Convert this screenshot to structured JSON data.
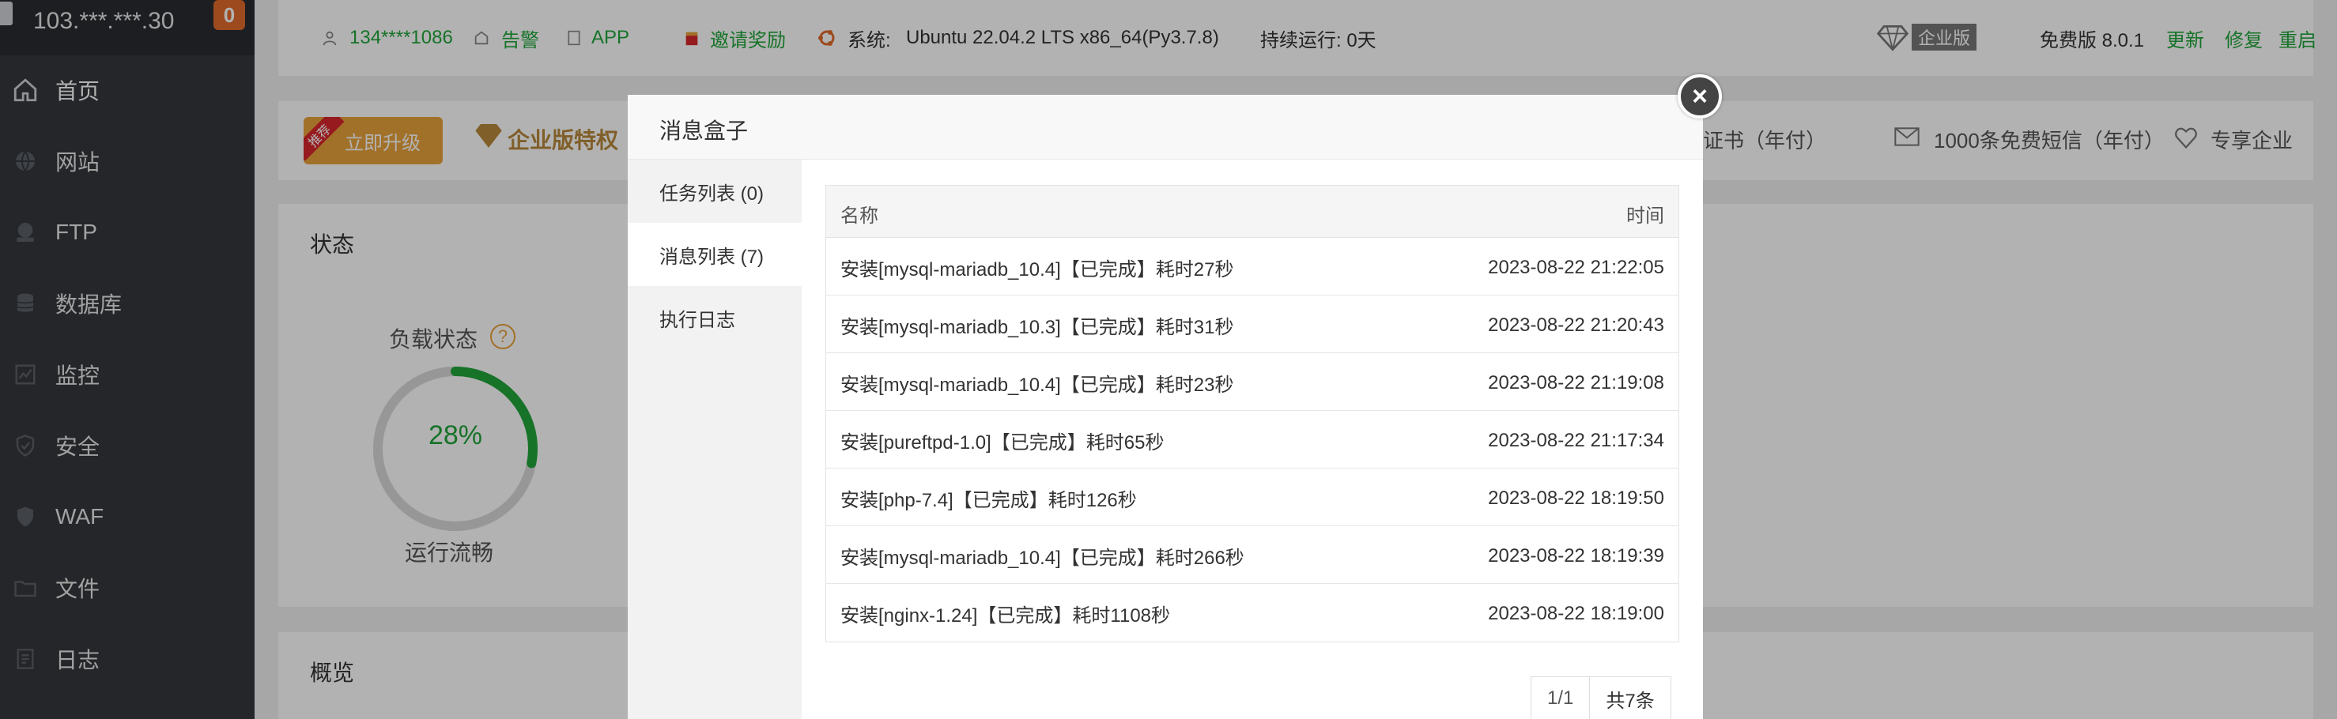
{
  "sidebar": {
    "server_ip": "103.***.***.30",
    "badge_count": "0",
    "items": [
      {
        "label": "首页",
        "icon": "home-icon"
      },
      {
        "label": "网站",
        "icon": "globe-icon"
      },
      {
        "label": "FTP",
        "icon": "ftp-icon"
      },
      {
        "label": "数据库",
        "icon": "database-icon"
      },
      {
        "label": "监控",
        "icon": "monitor-icon"
      },
      {
        "label": "安全",
        "icon": "shield-icon"
      },
      {
        "label": "WAF",
        "icon": "waf-shield-icon"
      },
      {
        "label": "文件",
        "icon": "folder-icon"
      },
      {
        "label": "日志",
        "icon": "log-icon"
      }
    ]
  },
  "topbar": {
    "user": "134****1086",
    "alert": "告警",
    "app": "APP",
    "invite": "邀请奖励",
    "system_label": "系统:",
    "system_value": "Ubuntu 22.04.2 LTS x86_64(Py3.7.8)",
    "uptime": "持续运行: 0天",
    "edition_tag": "企业版",
    "version": "免费版 8.0.1",
    "update": "更新",
    "repair": "修复",
    "restart": "重启"
  },
  "banner": {
    "ribbon": "推荐",
    "upgrade_label": "立即升级",
    "enterprise_title": "企业版特权",
    "right_items": [
      "用证书（年付）",
      "1000条免费短信（年付）",
      "专享企业"
    ]
  },
  "status": {
    "title": "状态",
    "load_label": "负载状态",
    "load_percent": 28,
    "load_text": "28%",
    "run_label": "运行流畅"
  },
  "overview": {
    "title": "概览"
  },
  "modal": {
    "title": "消息盒子",
    "close": "×",
    "tabs": [
      {
        "label": "任务列表 (0)"
      },
      {
        "label": "消息列表 (7)"
      },
      {
        "label": "执行日志"
      }
    ],
    "table": {
      "col_name": "名称",
      "col_time": "时间",
      "rows": [
        {
          "name": "安装[mysql-mariadb_10.4]【已完成】耗时27秒",
          "time": "2023-08-22 21:22:05"
        },
        {
          "name": "安装[mysql-mariadb_10.3]【已完成】耗时31秒",
          "time": "2023-08-22 21:20:43"
        },
        {
          "name": "安装[mysql-mariadb_10.4]【已完成】耗时23秒",
          "time": "2023-08-22 21:19:08"
        },
        {
          "name": "安装[pureftpd-1.0]【已完成】耗时65秒",
          "time": "2023-08-22 21:17:34"
        },
        {
          "name": "安装[php-7.4]【已完成】耗时126秒",
          "time": "2023-08-22 18:19:50"
        },
        {
          "name": "安装[mysql-mariadb_10.4]【已完成】耗时266秒",
          "time": "2023-08-22 18:19:39"
        },
        {
          "name": "安装[nginx-1.24]【已完成】耗时1108秒",
          "time": "2023-08-22 18:19:00"
        }
      ]
    },
    "pager": {
      "page": "1/1",
      "total": "共7条"
    }
  },
  "colors": {
    "accent_green": "#20a53a",
    "sidebar_bg": "#34373c",
    "badge_orange": "#e06a2b",
    "upgrade_gold": "#e9a23b"
  }
}
